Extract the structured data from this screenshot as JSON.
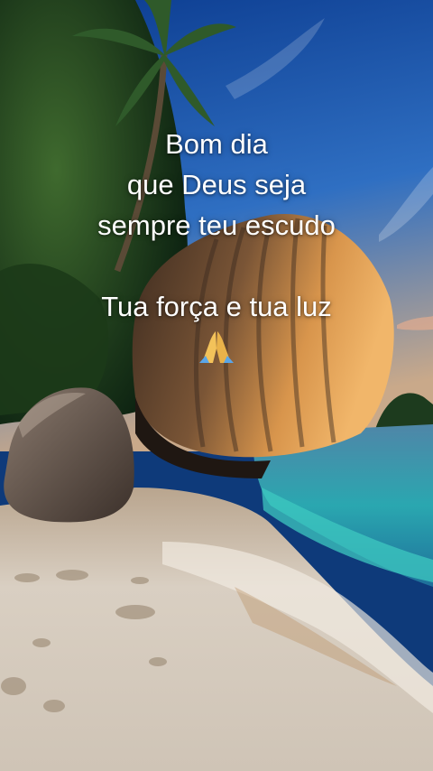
{
  "caption": {
    "line1": "Bom dia",
    "line2": "que Deus seja",
    "line3": "sempre teu escudo",
    "line4": "Tua força e tua luz"
  },
  "icons": {
    "emoji": "folded-hands-icon"
  },
  "colors": {
    "sky_top": "#0f3f8c",
    "sky_bottom": "#6f9fd4",
    "boulder_light": "#e7a65a",
    "boulder_dark": "#3a2a20",
    "sea_turquoise": "#2fb6b0",
    "sand": "#d8cdbf",
    "text": "#ffffff"
  }
}
